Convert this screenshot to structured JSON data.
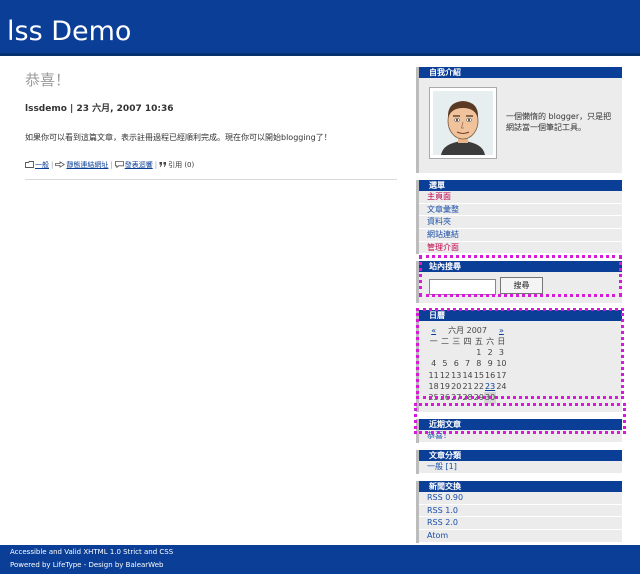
{
  "site": {
    "title": "lss Demo"
  },
  "post": {
    "title": "恭喜！",
    "meta": "lssdemo | 23 六月, 2007 10:36",
    "body": "如果你可以看到這篇文章，表示註冊過程已經順利完成。現在你可以開始blogging了！",
    "category_link": "一般",
    "permalink": "靜態連結網址",
    "comment_link": "發表迴響",
    "trackback_label": "引用",
    "trackback_count": "(0)"
  },
  "sidebar": {
    "about": {
      "heading": "自我介紹",
      "text": "一個懶惰的 blogger，只是把網誌當一個筆記工具。"
    },
    "menu": {
      "heading": "選單",
      "items": [
        {
          "label": "主頁面",
          "color": "#c0004a"
        },
        {
          "label": "文章彙整",
          "color": "#1a4fa8"
        },
        {
          "label": "資料夾",
          "color": "#1a4fa8"
        },
        {
          "label": "網站連結",
          "color": "#1a4fa8"
        },
        {
          "label": "管理介面",
          "color": "#c0004a"
        }
      ]
    },
    "search": {
      "heading": "站內搜尋",
      "button_label": "搜尋",
      "input_value": ""
    },
    "calendar": {
      "heading": "日曆",
      "prev": "«",
      "month": "六月 2007",
      "next": "»",
      "weekdays": [
        "一",
        "二",
        "三",
        "四",
        "五",
        "六",
        "日"
      ],
      "weeks": [
        [
          "",
          "",
          "",
          "",
          "1",
          "2",
          "3"
        ],
        [
          "4",
          "5",
          "6",
          "7",
          "8",
          "9",
          "10"
        ],
        [
          "11",
          "12",
          "13",
          "14",
          "15",
          "16",
          "17"
        ],
        [
          "18",
          "19",
          "20",
          "21",
          "22",
          "23",
          "24"
        ],
        [
          "25",
          "26",
          "27",
          "28",
          "29",
          "30",
          ""
        ]
      ],
      "linked_day": "23",
      "highlighted_day": "30"
    },
    "recent": {
      "heading": "近期文章",
      "items": [
        "恭喜！"
      ]
    },
    "categories": {
      "heading": "文章分類",
      "items": [
        "一般 [1]"
      ]
    },
    "feeds": {
      "heading": "新聞交換",
      "items": [
        "RSS 0.90",
        "RSS 1.0",
        "RSS 2.0",
        "Atom"
      ]
    }
  },
  "footer": {
    "line1": "Accessible and Valid XHTML 1.0 Strict and CSS",
    "line2": "Powered by LifeType - Design by BalearWeb"
  },
  "colors": {
    "header": "#0a3e97",
    "highlight_dots": "#d81ad8",
    "sidebar_bg": "#ececec"
  },
  "icons": [
    "folder-icon",
    "permalink-icon",
    "comment-icon",
    "quote-icon"
  ]
}
